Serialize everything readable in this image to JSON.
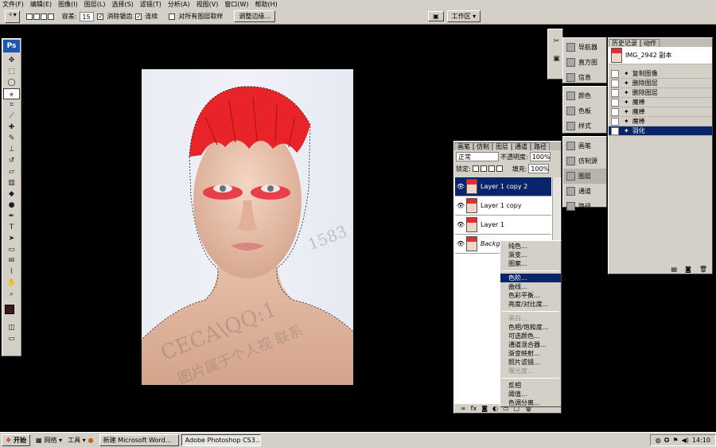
{
  "menubar": {
    "items": [
      "文件(F)",
      "编辑(E)",
      "图像(I)",
      "图层(L)",
      "选择(S)",
      "滤镜(T)",
      "分析(A)",
      "视图(V)",
      "窗口(W)",
      "帮助(H)"
    ]
  },
  "options": {
    "tolerance_label": "容差:",
    "tolerance_value": "15",
    "antialias_label": "消除锯齿",
    "contiguous_label": "连续",
    "all_layers_label": "对所有图层取样",
    "refine_edge_label": "调整边缘...",
    "workspace_label": "工作区 ▾"
  },
  "toolbox": {
    "logo": "Ps",
    "tools": [
      "move-icon",
      "marquee-icon",
      "lasso-icon",
      "magic-wand-icon",
      "crop-icon",
      "slice-icon",
      "healing-icon",
      "brush-icon",
      "stamp-icon",
      "history-brush-icon",
      "eraser-icon",
      "gradient-icon",
      "blur-icon",
      "dodge-icon",
      "pen-icon",
      "type-icon",
      "path-select-icon",
      "shape-icon",
      "notes-icon",
      "eyedropper-icon",
      "hand-icon",
      "zoom-icon"
    ]
  },
  "canvas": {
    "watermark1": "CECA\\QQ:1",
    "watermark2": "图片属于个人视 联系",
    "watermark3": "1583"
  },
  "layers": {
    "tabs": [
      "画笔",
      "仿制",
      "图层",
      "通道",
      "路径"
    ],
    "blend_mode": "正常",
    "opacity_label": "不透明度:",
    "opacity_value": "100%",
    "lock_label": "锁定:",
    "fill_label": "填充:",
    "fill_value": "100%",
    "rows": [
      {
        "name": "Layer 1 copy 2",
        "selected": true
      },
      {
        "name": "Layer 1 copy",
        "selected": false
      },
      {
        "name": "Layer 1",
        "selected": false
      },
      {
        "name": "Backgr",
        "selected": false
      }
    ]
  },
  "context_menu": {
    "groups": [
      [
        {
          "label": "纯色...",
          "disabled": false
        },
        {
          "label": "渐变...",
          "disabled": false
        },
        {
          "label": "图案...",
          "disabled": false
        }
      ],
      [
        {
          "label": "色阶...",
          "disabled": false,
          "highlight": true
        },
        {
          "label": "曲线...",
          "disabled": false
        },
        {
          "label": "色彩平衡...",
          "disabled": false
        },
        {
          "label": "亮度/对比度...",
          "disabled": false
        }
      ],
      [
        {
          "label": "黑白...",
          "disabled": true
        },
        {
          "label": "色相/饱和度...",
          "disabled": false
        },
        {
          "label": "可选颜色...",
          "disabled": false
        },
        {
          "label": "通道混合器...",
          "disabled": false
        },
        {
          "label": "渐变映射...",
          "disabled": false
        },
        {
          "label": "照片滤镜...",
          "disabled": false
        },
        {
          "label": "曝光度...",
          "disabled": true
        }
      ],
      [
        {
          "label": "反相",
          "disabled": false
        },
        {
          "label": "阈值...",
          "disabled": false
        },
        {
          "label": "色调分离...",
          "disabled": false
        }
      ]
    ]
  },
  "dock1": {
    "items": [
      "导航器",
      "直方图",
      "信息"
    ]
  },
  "dock2": {
    "items": [
      "颜色",
      "色板",
      "样式"
    ]
  },
  "dock3": {
    "items": [
      "画笔",
      "仿制源",
      "图层",
      "通道",
      "路径"
    ]
  },
  "history": {
    "tabs": [
      "历史记录",
      "动作"
    ],
    "snapshot": "IMG_2942 副本",
    "items": [
      {
        "label": "复制图像",
        "selected": false
      },
      {
        "label": "删除图层",
        "selected": false
      },
      {
        "label": "删除图层",
        "selected": false
      },
      {
        "label": "魔棒",
        "selected": false
      },
      {
        "label": "魔棒",
        "selected": false
      },
      {
        "label": "魔棒",
        "selected": false
      },
      {
        "label": "羽化",
        "selected": true
      }
    ]
  },
  "taskbar": {
    "start": "开始",
    "network": "网络 ▾",
    "tools": "工具 ▾",
    "tasks": [
      {
        "label": "新建 Microsoft Word...",
        "active": false
      },
      {
        "label": "Adobe Photoshop CS3...",
        "active": true
      }
    ],
    "clock": "14:10"
  }
}
